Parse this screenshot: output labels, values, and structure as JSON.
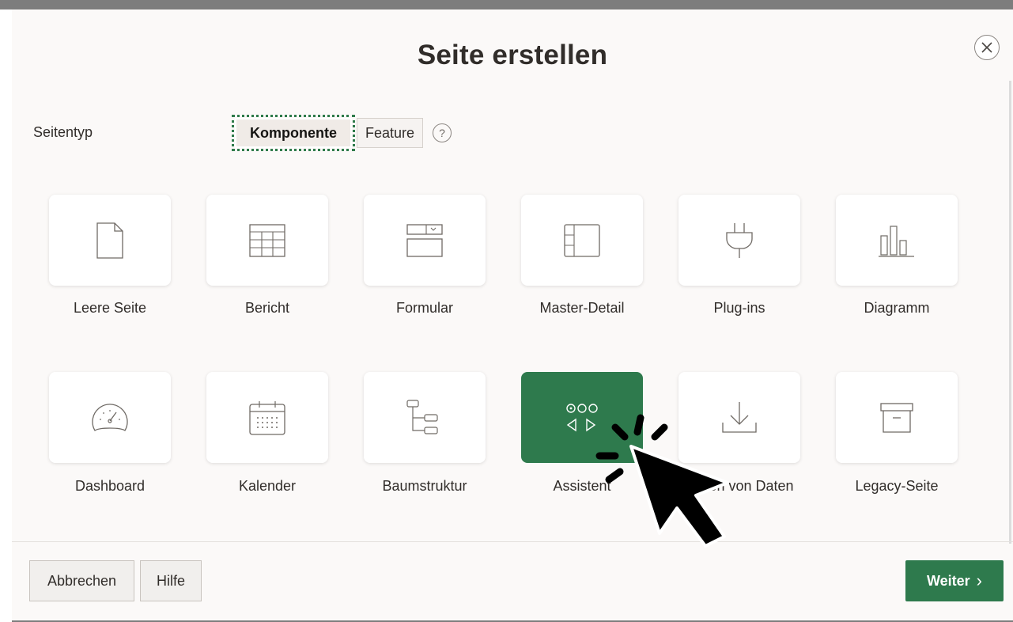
{
  "dialog": {
    "title": "Seite erstellen",
    "close_icon": "close-icon"
  },
  "page_type": {
    "label": "Seitentyp",
    "options": [
      "Komponente",
      "Feature"
    ],
    "selected": "Komponente",
    "help_icon": "help-icon",
    "help_glyph": "?"
  },
  "cards": [
    {
      "label": "Leere Seite",
      "icon": "blank-page-icon"
    },
    {
      "label": "Bericht",
      "icon": "report-table-icon"
    },
    {
      "label": "Formular",
      "icon": "form-icon"
    },
    {
      "label": "Master-Detail",
      "icon": "master-detail-icon"
    },
    {
      "label": "Plug-ins",
      "icon": "plug-icon"
    },
    {
      "label": "Diagramm",
      "icon": "bar-chart-icon"
    },
    {
      "label": "Dashboard",
      "icon": "gauge-icon"
    },
    {
      "label": "Kalender",
      "icon": "calendar-icon"
    },
    {
      "label": "Baumstruktur",
      "icon": "tree-icon"
    },
    {
      "label": "Assistent",
      "icon": "wizard-icon",
      "selected": true
    },
    {
      "label": "Laden von Daten",
      "icon": "download-icon"
    },
    {
      "label": "Legacy-Seite",
      "icon": "archive-icon"
    }
  ],
  "footer": {
    "cancel_label": "Abbrechen",
    "help_label": "Hilfe",
    "next_label": "Weiter",
    "next_chevron": "›"
  },
  "colors": {
    "accent": "#2e7a4d",
    "background": "#fbf9f8",
    "card": "#ffffff"
  }
}
